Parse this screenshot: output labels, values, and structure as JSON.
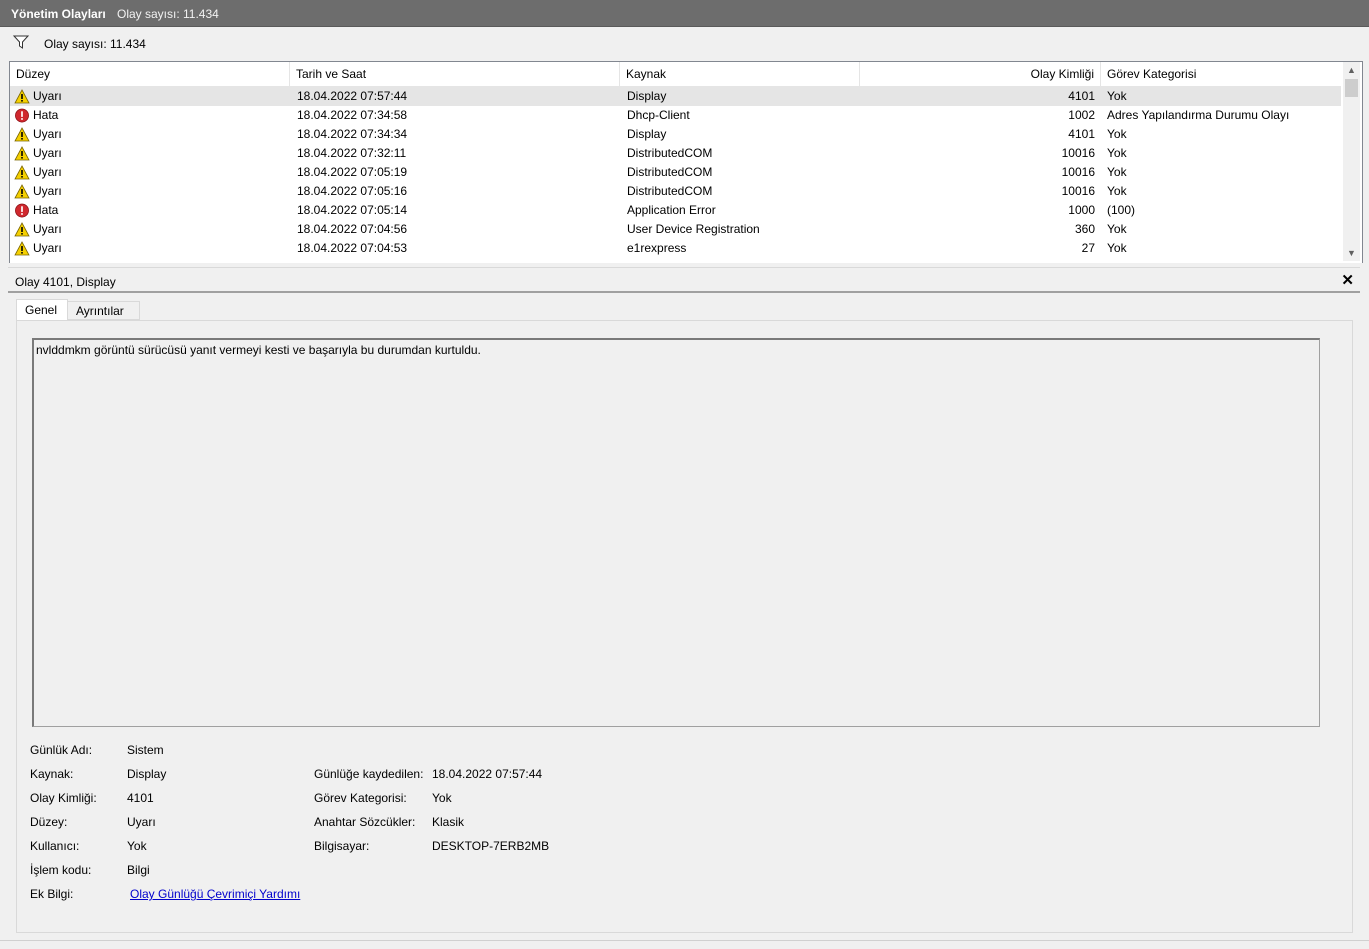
{
  "header": {
    "title": "Yönetim Olayları",
    "count_text": "Olay sayısı: 11.434"
  },
  "filter": {
    "count_text": "Olay sayısı: 11.434",
    "icon": "filter-icon"
  },
  "grid": {
    "columns": [
      "Düzey",
      "Tarih ve Saat",
      "Kaynak",
      "Olay Kimliği",
      "Görev Kategorisi"
    ],
    "rows": [
      {
        "level": "Uyarı",
        "icon": "warning-icon",
        "date": "18.04.2022 07:57:44",
        "source": "Display",
        "id": "4101",
        "category": "Yok"
      },
      {
        "level": "Hata",
        "icon": "error-icon",
        "date": "18.04.2022 07:34:58",
        "source": "Dhcp-Client",
        "id": "1002",
        "category": "Adres Yapılandırma Durumu Olayı"
      },
      {
        "level": "Uyarı",
        "icon": "warning-icon",
        "date": "18.04.2022 07:34:34",
        "source": "Display",
        "id": "4101",
        "category": "Yok"
      },
      {
        "level": "Uyarı",
        "icon": "warning-icon",
        "date": "18.04.2022 07:32:11",
        "source": "DistributedCOM",
        "id": "10016",
        "category": "Yok"
      },
      {
        "level": "Uyarı",
        "icon": "warning-icon",
        "date": "18.04.2022 07:05:19",
        "source": "DistributedCOM",
        "id": "10016",
        "category": "Yok"
      },
      {
        "level": "Uyarı",
        "icon": "warning-icon",
        "date": "18.04.2022 07:05:16",
        "source": "DistributedCOM",
        "id": "10016",
        "category": "Yok"
      },
      {
        "level": "Hata",
        "icon": "error-icon",
        "date": "18.04.2022 07:05:14",
        "source": "Application Error",
        "id": "1000",
        "category": "(100)"
      },
      {
        "level": "Uyarı",
        "icon": "warning-icon",
        "date": "18.04.2022 07:04:56",
        "source": "User Device Registration",
        "id": "360",
        "category": "Yok"
      },
      {
        "level": "Uyarı",
        "icon": "warning-icon",
        "date": "18.04.2022 07:04:53",
        "source": "e1rexpress",
        "id": "27",
        "category": "Yok"
      }
    ]
  },
  "detail": {
    "title": "Olay 4101, Display",
    "close_glyph": "✕",
    "tabs": [
      "Genel",
      "Ayrıntılar"
    ],
    "message": "nvlddmkm görüntü sürücüsü yanıt vermeyi kesti ve başarıyla bu durumdan kurtuldu.",
    "left_props": [
      {
        "label": "Günlük Adı:",
        "value": "Sistem"
      },
      {
        "label": "Kaynak:",
        "value": "Display"
      },
      {
        "label": "Olay Kimliği:",
        "value": "4101"
      },
      {
        "label": "Düzey:",
        "value": "Uyarı"
      },
      {
        "label": "Kullanıcı:",
        "value": "Yok"
      },
      {
        "label": "İşlem kodu:",
        "value": "Bilgi"
      },
      {
        "label": "Ek Bilgi:",
        "value": "Olay Günlüğü Çevrimiçi Yardımı"
      }
    ],
    "right_props": [
      {
        "label": "Günlüğe kaydedilen:",
        "value": "18.04.2022 07:57:44"
      },
      {
        "label": "Görev Kategorisi:",
        "value": "Yok"
      },
      {
        "label": "Anahtar Sözcükler:",
        "value": "Klasik"
      },
      {
        "label": "Bilgisayar:",
        "value": "DESKTOP-7ERB2MB"
      }
    ]
  }
}
